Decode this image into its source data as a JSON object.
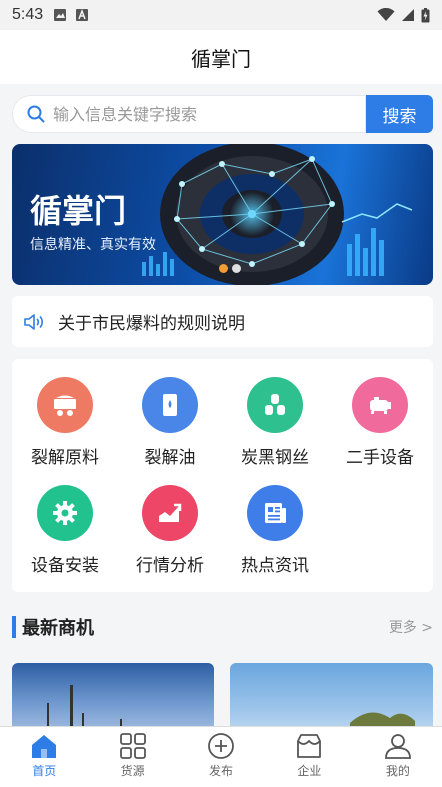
{
  "status_bar": {
    "time": "5:43"
  },
  "header": {
    "title": "循掌门"
  },
  "search": {
    "placeholder": "输入信息关键字搜索",
    "button_label": "搜索"
  },
  "banner": {
    "title": "循掌门",
    "subtitle": "信息精准、真实有效",
    "slides": 2,
    "active_slide": 0
  },
  "notice": {
    "text": "关于市民爆料的规则说明"
  },
  "categories": [
    {
      "label": "裂解原料",
      "icon": "cart-icon",
      "color": "#ef7a63"
    },
    {
      "label": "裂解油",
      "icon": "oil-barrel-icon",
      "color": "#4a86e8"
    },
    {
      "label": "炭黑钢丝",
      "icon": "wire-coils-icon",
      "color": "#2ec08f"
    },
    {
      "label": "二手设备",
      "icon": "machine-icon",
      "color": "#f06b9b"
    },
    {
      "label": "设备安装",
      "icon": "gear-icon",
      "color": "#22c28e"
    },
    {
      "label": "行情分析",
      "icon": "trend-chart-icon",
      "color": "#ee4667"
    },
    {
      "label": "热点资讯",
      "icon": "news-icon",
      "color": "#3f7ee8"
    }
  ],
  "section": {
    "title": "最新商机",
    "more": "更多 >"
  },
  "tabbar": [
    {
      "label": "首页",
      "icon": "home-icon",
      "active": true
    },
    {
      "label": "货源",
      "icon": "grid-icon",
      "active": false
    },
    {
      "label": "发布",
      "icon": "plus-circle-icon",
      "active": false
    },
    {
      "label": "企业",
      "icon": "shop-icon",
      "active": false
    },
    {
      "label": "我的",
      "icon": "user-icon",
      "active": false
    }
  ],
  "colors": {
    "accent": "#2e7de6",
    "background": "#f4f5f7"
  }
}
